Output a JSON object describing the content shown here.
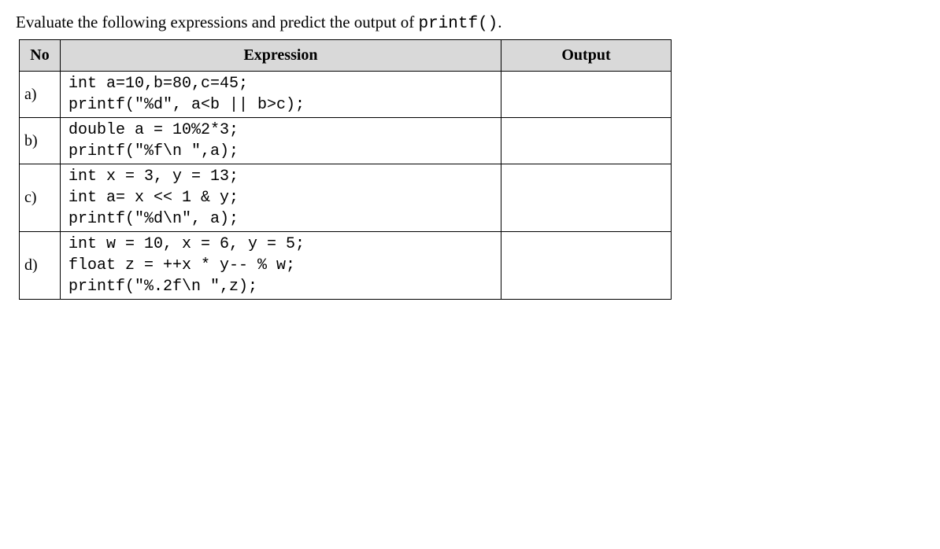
{
  "prompt": {
    "before": "Evaluate the following expressions and predict the output of ",
    "code": "printf()",
    "after": "."
  },
  "headers": {
    "no": "No",
    "expression": "Expression",
    "output": "Output"
  },
  "rows": [
    {
      "no": "a)",
      "expression": "int a=10,b=80,c=45;\nprintf(\"%d\", a<b || b>c);",
      "output": ""
    },
    {
      "no": "b)",
      "expression": "double a = 10%2*3;\nprintf(\"%f\\n \",a);",
      "output": ""
    },
    {
      "no": "c)",
      "expression": "int x = 3, y = 13;\nint a= x << 1 & y;\nprintf(\"%d\\n\", a);",
      "output": ""
    },
    {
      "no": "d)",
      "expression": "int w = 10, x = 6, y = 5;\nfloat z = ++x * y-- % w;\nprintf(\"%.2f\\n \",z);",
      "output": ""
    }
  ]
}
